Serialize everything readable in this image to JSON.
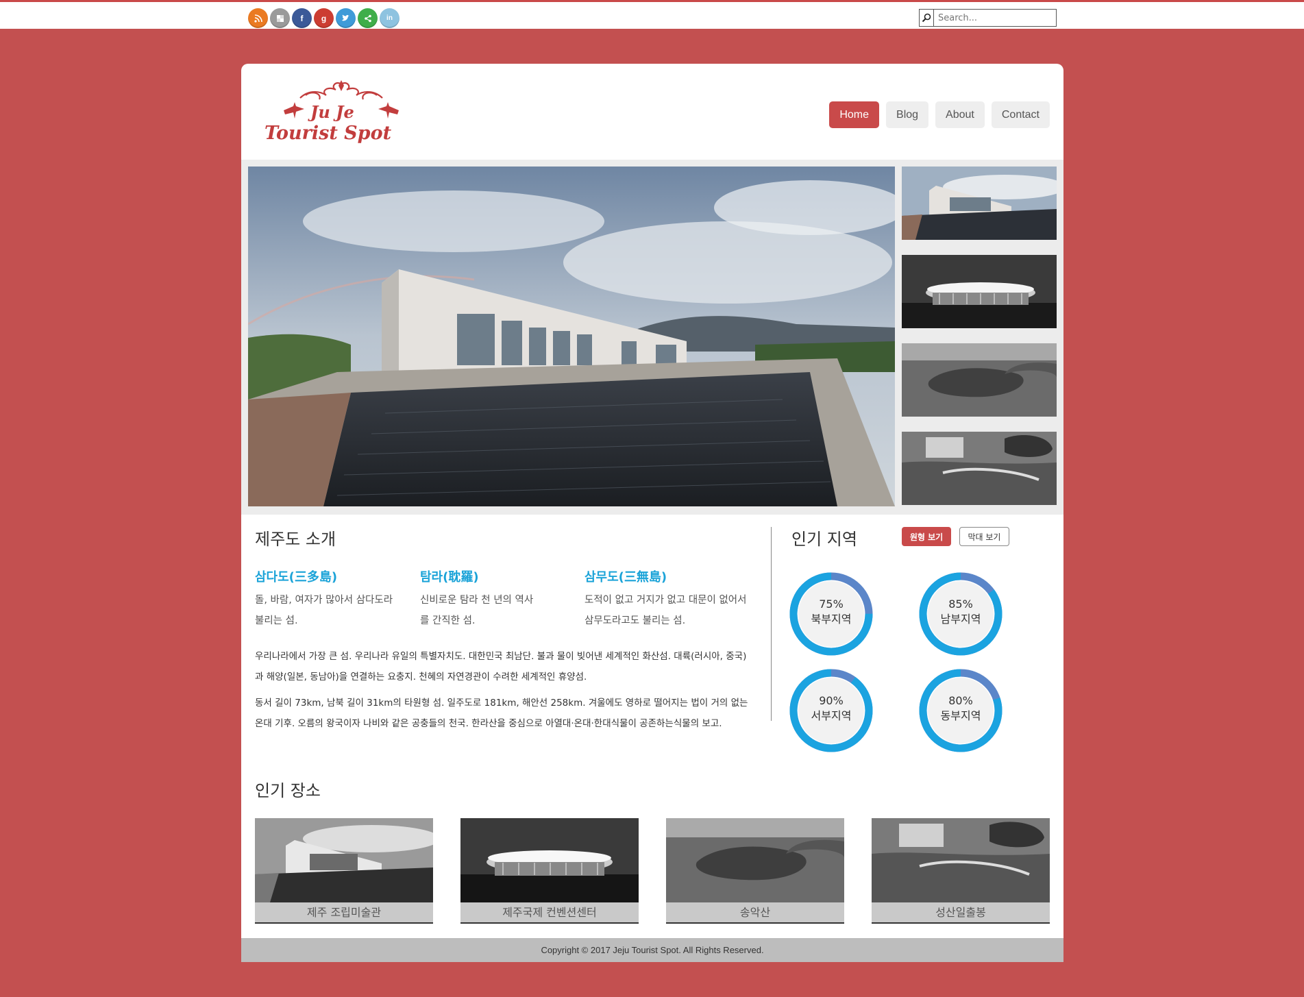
{
  "social": [
    {
      "name": "rss-icon",
      "color": "#ea7a22",
      "glyph": ")"
    },
    {
      "name": "delicious-icon",
      "color": "#9a9a9a",
      "glyph": "▣"
    },
    {
      "name": "facebook-icon",
      "color": "#3b5998",
      "glyph": "f"
    },
    {
      "name": "google-plus-icon",
      "color": "#cc3d32",
      "glyph": "g"
    },
    {
      "name": "twitter-icon",
      "color": "#3f9bd8",
      "glyph": "•"
    },
    {
      "name": "share-icon",
      "color": "#3fae4a",
      "glyph": "<"
    },
    {
      "name": "linkedin-icon",
      "color": "#8ec3e0",
      "glyph": "in"
    }
  ],
  "search": {
    "placeholder": "Search..."
  },
  "logo": {
    "line1": "Ju Je",
    "line2": "Tourist Spot"
  },
  "nav": [
    {
      "label": "Home",
      "active": true
    },
    {
      "label": "Blog",
      "active": false
    },
    {
      "label": "About",
      "active": false
    },
    {
      "label": "Contact",
      "active": false
    }
  ],
  "intro": {
    "title": "제주도 소개",
    "columns": [
      {
        "head": "삼다도(三多島)",
        "text": "돌, 바람, 여자가 많아서 삼다도라 불리는 섬."
      },
      {
        "head": "탐라(耽羅)",
        "text": "신비로운 탐라 천 년의 역사를 간직한 섬."
      },
      {
        "head": "삼무도(三無島)",
        "text": "도적이 없고 거지가 없고 대문이 없어서 삼무도라고도 불리는 섬."
      }
    ],
    "para1": "우리나라에서 가장 큰 섬. 우리나라 유일의 특별자치도. 대한민국 최남단. 불과 물이 빚어낸 세계적인 화산섬. 대륙(러시아, 중국)과 해양(일본, 동남아)을 연결하는 요충지. 천혜의 자연경관이 수려한 세계적인 휴양섬.",
    "para2": "동서 길이 73km, 남북 길이 31km의 타원형 섬. 일주도로 181km, 해안선 258km. 겨울에도 영하로 떨어지는 법이 거의 없는 온대 기후. 오름의 왕국이자 나비와 같은 공충들의 천국. 한라산을 중심으로 아열대·온대·한대식물이 공존하는식물의 보고."
  },
  "popular_regions": {
    "title": "인기 지역",
    "toggle_circle": "원형 보기",
    "toggle_bar": "막대 보기",
    "accent": "#1ba3e0",
    "track": "#5b86c9",
    "regions": [
      {
        "value": 75,
        "pct": "75%",
        "name": "북부지역"
      },
      {
        "value": 85,
        "pct": "85%",
        "name": "남부지역"
      },
      {
        "value": 90,
        "pct": "90%",
        "name": "서부지역"
      },
      {
        "value": 80,
        "pct": "80%",
        "name": "동부지역"
      }
    ]
  },
  "popular_places": {
    "title": "인기 장소",
    "items": [
      {
        "caption": "제주 조립미술관"
      },
      {
        "caption": "제주국제 컨벤션센터"
      },
      {
        "caption": "송악산"
      },
      {
        "caption": "성산일출봉"
      }
    ]
  },
  "footer": "Copyright © 2017 Jeju Tourist Spot. All Rights Reserved."
}
